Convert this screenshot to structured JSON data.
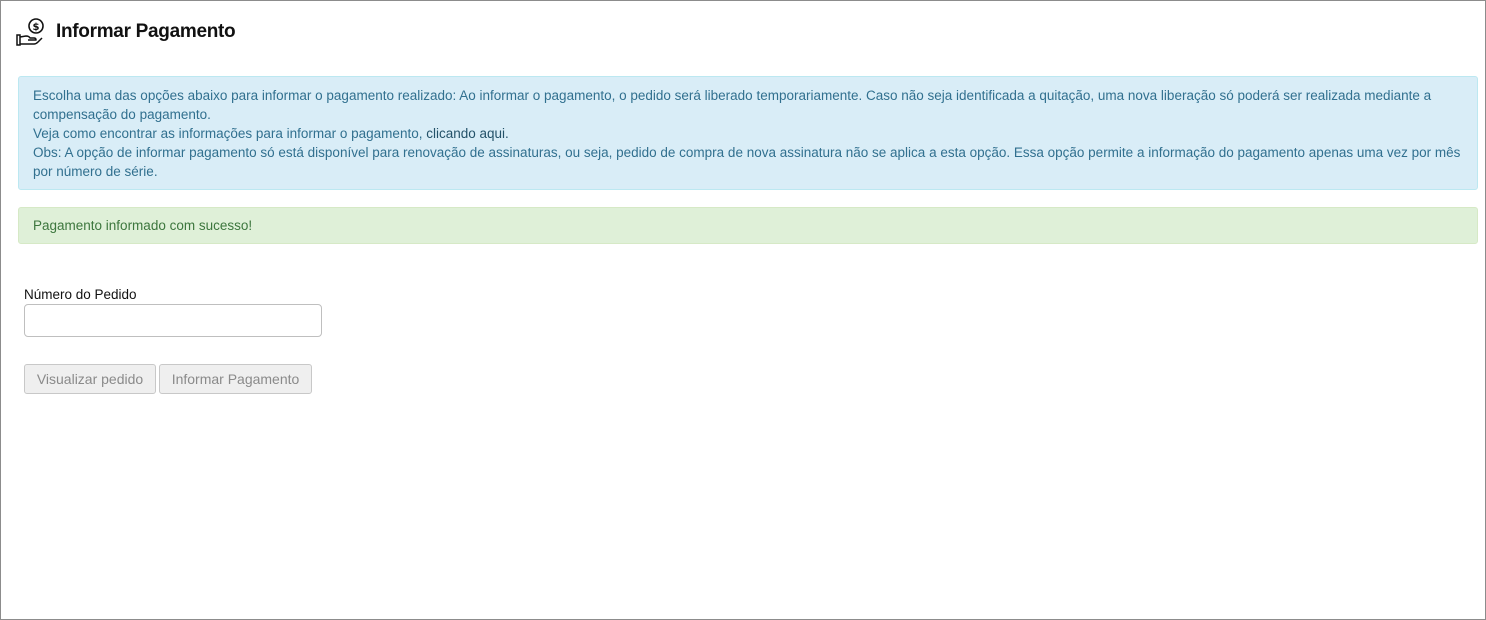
{
  "header": {
    "icon": "hand-coin-icon",
    "title": "Informar Pagamento"
  },
  "info": {
    "line1": "Escolha uma das opções abaixo para informar o pagamento realizado: Ao informar o pagamento, o pedido será liberado temporariamente. Caso não seja identificada a quitação, uma nova liberação só poderá ser realizada mediante a compensação do pagamento.",
    "line2_prefix": "Veja como encontrar as informações para informar o pagamento, ",
    "line2_link": "clicando aqui.",
    "line3": "Obs: A opção de informar pagamento só está disponível para renovação de assinaturas, ou seja, pedido de compra de nova assinatura não se aplica a esta opção. Essa opção permite a informação do pagamento apenas uma vez por mês por número de série."
  },
  "success": {
    "message": "Pagamento informado com sucesso!"
  },
  "form": {
    "order_label": "Número do Pedido",
    "order_value": "",
    "view_button": "Visualizar pedido",
    "inform_button": "Informar Pagamento"
  },
  "colors": {
    "info_bg": "#d9edf7",
    "info_text": "#31708f",
    "success_bg": "#dff0d8",
    "success_text": "#3c763d"
  }
}
